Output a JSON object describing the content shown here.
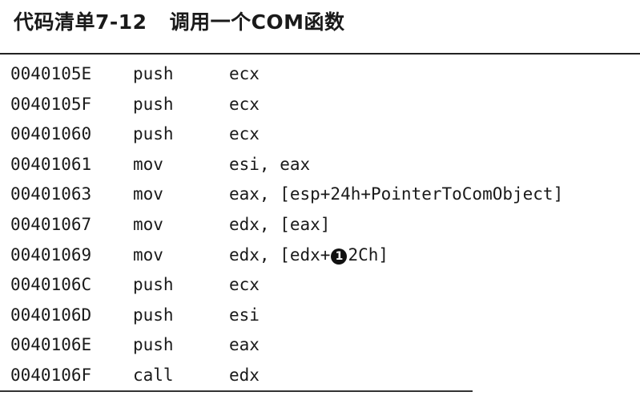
{
  "caption": {
    "label": "代码清单7-12",
    "title": "调用一个COM函数"
  },
  "code": [
    {
      "addr": "0040105E",
      "mnemonic": "push",
      "operands": "ecx"
    },
    {
      "addr": "0040105F",
      "mnemonic": "push",
      "operands": "ecx"
    },
    {
      "addr": "00401060",
      "mnemonic": "push",
      "operands": "ecx"
    },
    {
      "addr": "00401061",
      "mnemonic": "mov",
      "operands": "esi, eax"
    },
    {
      "addr": "00401063",
      "mnemonic": "mov",
      "operands": "eax, [esp+24h+PointerToComObject]"
    },
    {
      "addr": "00401067",
      "mnemonic": "mov",
      "operands": "edx, [eax]"
    },
    {
      "addr": "00401069",
      "mnemonic": "mov",
      "operands_before": "edx, [edx+",
      "marker": "1",
      "operands_after": "2Ch]"
    },
    {
      "addr": "0040106C",
      "mnemonic": "push",
      "operands": "ecx"
    },
    {
      "addr": "0040106D",
      "mnemonic": "push",
      "operands": "esi"
    },
    {
      "addr": "0040106E",
      "mnemonic": "push",
      "operands": "eax"
    },
    {
      "addr": "0040106F",
      "mnemonic": "call",
      "operands": "edx"
    }
  ]
}
